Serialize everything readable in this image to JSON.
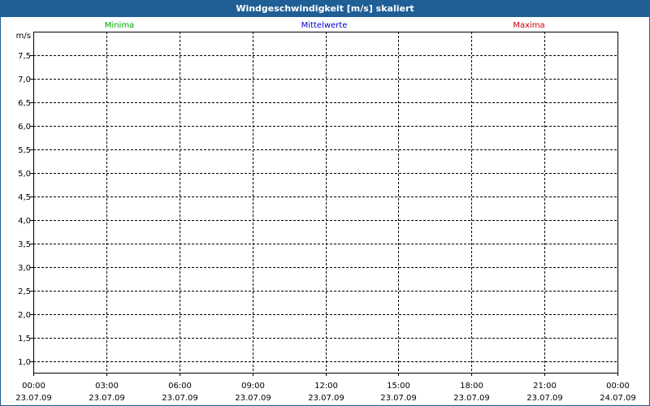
{
  "window": {
    "title": "Windgeschwindigkeit [m/s] skaliert"
  },
  "colors": {
    "titlebar": "#1f5f95",
    "minima": "#00aa00",
    "mittelwerte": "#0000cc",
    "maxima": "#cc0000",
    "grid": "#000000"
  },
  "chart_data": {
    "type": "line",
    "title": "Windgeschwindigkeit [m/s] skaliert",
    "ylabel": "m/s",
    "xlabel": "",
    "ylim": [
      0.75,
      8.0
    ],
    "yticks": [
      1.0,
      1.5,
      2.0,
      2.5,
      3.0,
      3.5,
      4.0,
      4.5,
      5.0,
      5.5,
      6.0,
      6.5,
      7.0,
      7.5
    ],
    "ytick_labels": [
      "1,0",
      "1,5",
      "2,0",
      "2,5",
      "3,0",
      "3,5",
      "4,0",
      "4,5",
      "5,0",
      "5,5",
      "6,0",
      "6,5",
      "7,0",
      "7,5"
    ],
    "xticks": [
      {
        "time": "00:00",
        "date": "23.07.09"
      },
      {
        "time": "03:00",
        "date": "23.07.09"
      },
      {
        "time": "06:00",
        "date": "23.07.09"
      },
      {
        "time": "09:00",
        "date": "23.07.09"
      },
      {
        "time": "12:00",
        "date": "23.07.09"
      },
      {
        "time": "15:00",
        "date": "23.07.09"
      },
      {
        "time": "18:00",
        "date": "23.07.09"
      },
      {
        "time": "21:00",
        "date": "23.07.09"
      },
      {
        "time": "00:00",
        "date": "24.07.09"
      }
    ],
    "grid": true,
    "legend_placement": "top",
    "series": [
      {
        "name": "Minima",
        "values": []
      },
      {
        "name": "Mittelwerte",
        "values": []
      },
      {
        "name": "Maxima",
        "values": []
      }
    ]
  }
}
